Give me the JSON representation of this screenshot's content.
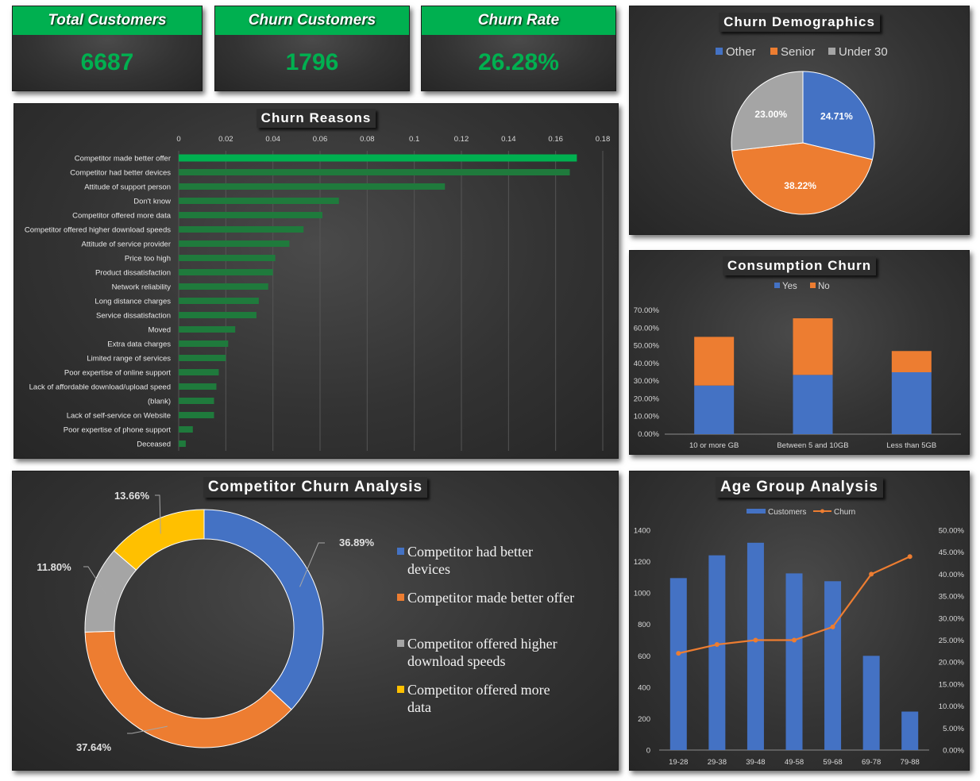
{
  "kpis": [
    {
      "label": "Total Customers",
      "value": "6687"
    },
    {
      "label": "Churn Customers",
      "value": "1796"
    },
    {
      "label": "Churn Rate",
      "value": "26.28%"
    }
  ],
  "colors": {
    "green": "#00b050",
    "blue": "#4472c4",
    "orange": "#ed7d31",
    "gray": "#a5a5a5",
    "yellow": "#ffc000",
    "bar_green": "#1f7a3c"
  },
  "chart_data": [
    {
      "id": "churn_reasons",
      "type": "bar",
      "orientation": "horizontal",
      "title": "Churn Reasons",
      "xlim": [
        0,
        0.18
      ],
      "xticks": [
        "0",
        "0.02",
        "0.04",
        "0.06",
        "0.08",
        "0.1",
        "0.12",
        "0.14",
        "0.16",
        "0.18"
      ],
      "categories": [
        "Competitor made better offer",
        "Competitor had better devices",
        "Attitude of support person",
        "Don't know",
        "Competitor offered more data",
        "Competitor offered higher download speeds",
        "Attitude of service provider",
        "Price too high",
        "Product dissatisfaction",
        "Network reliability",
        "Long distance charges",
        "Service dissatisfaction",
        "Moved",
        "Extra data charges",
        "Limited range of services",
        "Poor expertise of online support",
        "Lack of affordable download/upload speed",
        "(blank)",
        "Lack of self-service on Website",
        "Poor expertise of phone support",
        "Deceased"
      ],
      "values": [
        0.169,
        0.166,
        0.113,
        0.068,
        0.061,
        0.053,
        0.047,
        0.041,
        0.04,
        0.038,
        0.034,
        0.033,
        0.024,
        0.021,
        0.02,
        0.017,
        0.016,
        0.015,
        0.015,
        0.006,
        0.003
      ]
    },
    {
      "id": "churn_demographics",
      "type": "pie",
      "title": "Churn Demographics",
      "legend": "top",
      "categories": [
        "Other",
        "Senior",
        "Under 30"
      ],
      "values": [
        24.71,
        38.22,
        23.0
      ],
      "labels": [
        "24.71%",
        "38.22%",
        "23.00%"
      ]
    },
    {
      "id": "consumption_churn",
      "type": "bar",
      "stacked": true,
      "title": "Consumption Churn",
      "legend": "top",
      "categories": [
        "10 or more GB",
        "Between 5 and 10GB",
        "Less than 5GB"
      ],
      "series": [
        {
          "name": "Yes",
          "values": [
            0.275,
            0.335,
            0.35
          ]
        },
        {
          "name": "No",
          "values": [
            0.275,
            0.32,
            0.12
          ]
        }
      ],
      "ylim": [
        0,
        0.7
      ],
      "yticks": [
        "0.00%",
        "10.00%",
        "20.00%",
        "30.00%",
        "40.00%",
        "50.00%",
        "60.00%",
        "70.00%"
      ]
    },
    {
      "id": "competitor_churn",
      "type": "pie",
      "donut": true,
      "title": "Competitor Churn Analysis",
      "legend": "right",
      "categories": [
        "Competitor had better devices",
        "Competitor made better offer",
        "Competitor offered higher download speeds",
        "Competitor offered more data"
      ],
      "values": [
        36.89,
        37.64,
        11.8,
        13.66
      ],
      "labels": [
        "36.89%",
        "37.64%",
        "11.80%",
        "13.66%"
      ]
    },
    {
      "id": "age_group",
      "type": "bar",
      "title": "Age Group Analysis",
      "legend": "top",
      "categories": [
        "19-28",
        "29-38",
        "39-48",
        "49-58",
        "59-68",
        "69-78",
        "79-88"
      ],
      "series": [
        {
          "name": "Customers",
          "type": "bar",
          "axis": "left",
          "values": [
            1095,
            1240,
            1320,
            1125,
            1075,
            600,
            245
          ]
        },
        {
          "name": "Churn",
          "type": "line",
          "axis": "right",
          "values": [
            0.22,
            0.24,
            0.25,
            0.25,
            0.28,
            0.4,
            0.44
          ]
        }
      ],
      "ylim": [
        0,
        1400
      ],
      "yticks": [
        "0",
        "200",
        "400",
        "600",
        "800",
        "1000",
        "1200",
        "1400"
      ],
      "y2lim": [
        0,
        0.5
      ],
      "y2ticks": [
        "0.00%",
        "5.00%",
        "10.00%",
        "15.00%",
        "20.00%",
        "25.00%",
        "30.00%",
        "35.00%",
        "40.00%",
        "45.00%",
        "50.00%"
      ]
    }
  ]
}
